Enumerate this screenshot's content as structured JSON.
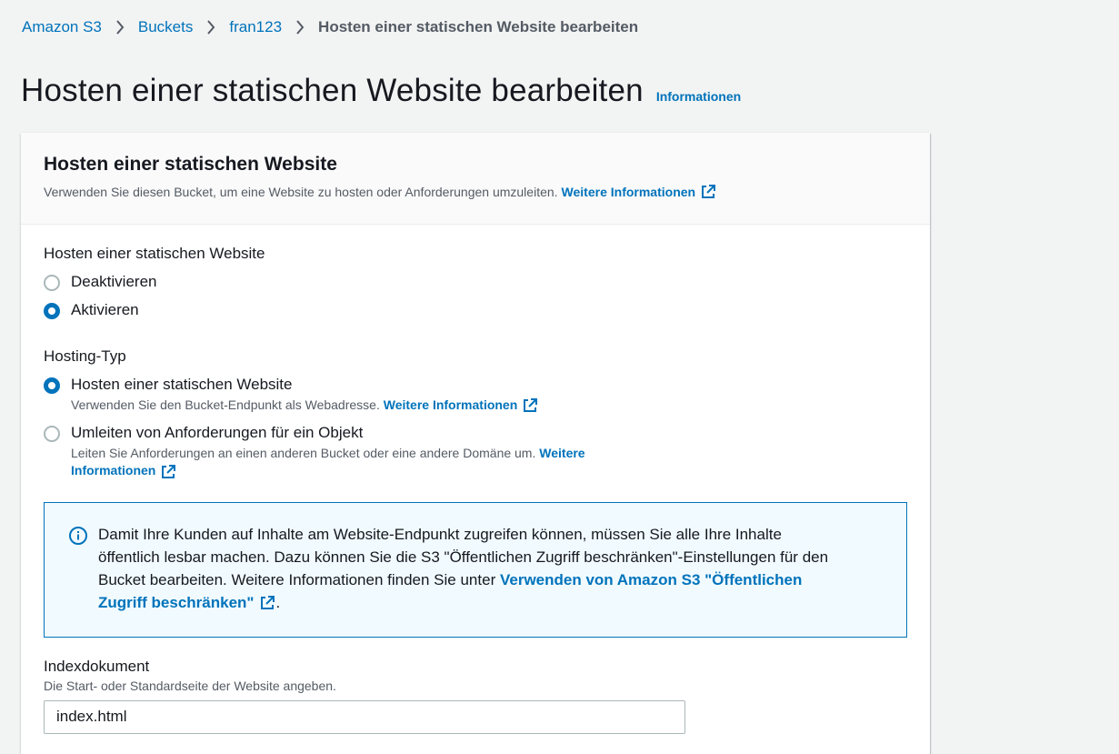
{
  "breadcrumb": {
    "items": [
      "Amazon S3",
      "Buckets",
      "fran123"
    ],
    "current": "Hosten einer statischen Website bearbeiten"
  },
  "header": {
    "title": "Hosten einer statischen Website bearbeiten",
    "info_link": "Informationen"
  },
  "panel": {
    "title": "Hosten einer statischen Website",
    "description": "Verwenden Sie diesen Bucket, um eine Website zu hosten oder Anforderungen umzuleiten.",
    "more_info": "Weitere Informationen"
  },
  "static_hosting": {
    "label": "Hosten einer statischen Website",
    "options": [
      {
        "label": "Deaktivieren",
        "checked": false
      },
      {
        "label": "Aktivieren",
        "checked": true
      }
    ]
  },
  "hosting_type": {
    "label": "Hosting-Typ",
    "options": [
      {
        "label": "Hosten einer statischen Website",
        "description": "Verwenden Sie den Bucket-Endpunkt als Webadresse.",
        "link": "Weitere Informationen",
        "checked": true
      },
      {
        "label": "Umleiten von Anforderungen für ein Objekt",
        "description": "Leiten Sie Anforderungen an einen anderen Bucket oder eine andere Domäne um.",
        "link_part1": "Weitere",
        "link_part2": "Informationen",
        "checked": false
      }
    ]
  },
  "alert": {
    "text_line1": "Damit Ihre Kunden auf Inhalte am Website-Endpunkt zugreifen können, müssen Sie alle Ihre Inhalte",
    "text_line2": "öffentlich lesbar machen. Dazu können Sie die S3 \"Öffentlichen Zugriff beschränken\"-Einstellungen für den",
    "text_line3": "Bucket bearbeiten. Weitere Informationen finden Sie unter",
    "link_part1": "Verwenden von Amazon S3 \"Öffentlichen",
    "link_part2": "Zugriff beschränken\"",
    "trailing": "."
  },
  "index_document": {
    "label": "Indexdokument",
    "description": "Die Start- oder Standardseite der Website angeben.",
    "value": "index.html"
  },
  "colors": {
    "link": "#0073bb",
    "background": "#f2f3f3",
    "alert_bg": "#f1faff"
  }
}
